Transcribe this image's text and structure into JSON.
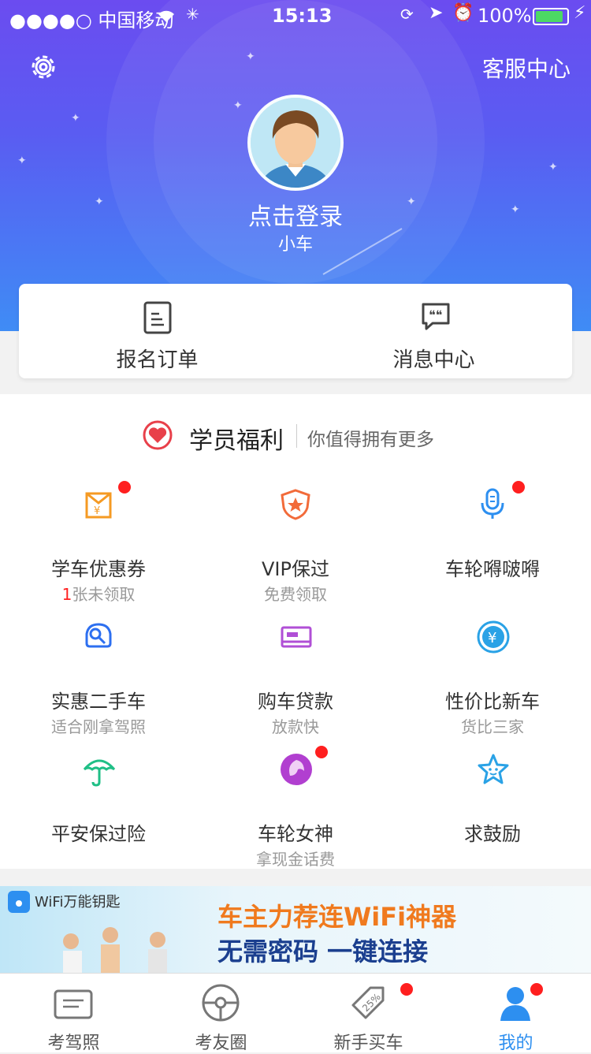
{
  "status_bar": {
    "carrier": "●●●●○ 中国移动",
    "time": "15:13",
    "battery": "100%",
    "battery_level": 1.0
  },
  "header": {
    "service_label": "客服中心",
    "login_label": "点击登录",
    "nickname": "小车"
  },
  "quick_actions": [
    {
      "label": "报名订单",
      "icon": "order-icon"
    },
    {
      "label": "消息中心",
      "icon": "message-icon"
    }
  ],
  "benefits": {
    "title": "学员福利",
    "subtitle": "你值得拥有更多",
    "items": [
      {
        "name": "学车优惠券",
        "sub_highlight": "1",
        "sub": "张未领取",
        "icon": "coupon-icon",
        "color": "#f59a23",
        "badge": true
      },
      {
        "name": "VIP保过",
        "sub_highlight": "",
        "sub": "免费领取",
        "icon": "shield-star-icon",
        "color": "#f26b3a",
        "badge": false
      },
      {
        "name": "车轮嘚啵嘚",
        "sub_highlight": "",
        "sub": "",
        "icon": "microphone-icon",
        "color": "#2d8ff0",
        "badge": true
      },
      {
        "name": "实惠二手车",
        "sub_highlight": "",
        "sub": "适合刚拿驾照",
        "icon": "car-key-icon",
        "color": "#2d6ff0",
        "badge": false
      },
      {
        "name": "购车贷款",
        "sub_highlight": "",
        "sub": "放款快",
        "icon": "card-icon",
        "color": "#b04fd6",
        "badge": false
      },
      {
        "name": "性价比新车",
        "sub_highlight": "",
        "sub": "货比三家",
        "icon": "yen-coin-icon",
        "color": "#2aa2e6",
        "badge": false
      },
      {
        "name": "平安保过险",
        "sub_highlight": "",
        "sub": "",
        "icon": "umbrella-icon",
        "color": "#1fbf86",
        "badge": false
      },
      {
        "name": "车轮女神",
        "sub_highlight": "",
        "sub": "拿现金话费",
        "icon": "goddess-icon",
        "color": "#b13fd0",
        "badge": true
      },
      {
        "name": "求鼓励",
        "sub_highlight": "",
        "sub": "",
        "icon": "star-icon",
        "color": "#2aa2e6",
        "badge": false
      }
    ]
  },
  "banner": {
    "logo_text": "WiFi万能钥匙",
    "line1": "车主力荐连WiFi神器",
    "line2": "无需密码  一键连接"
  },
  "tabs": [
    {
      "label": "考驾照",
      "icon": "license-icon",
      "active": false,
      "badge": false
    },
    {
      "label": "考友圈",
      "icon": "steering-wheel-icon",
      "active": false,
      "badge": false
    },
    {
      "label": "新手买车",
      "icon": "discount-tag-icon",
      "active": false,
      "badge": true
    },
    {
      "label": "我的",
      "icon": "profile-icon",
      "active": true,
      "badge": true
    }
  ],
  "colors": {
    "header_top": "#6b4cf0",
    "header_bottom": "#3f8cf5",
    "active_tab": "#2d8ff0",
    "badge": "#ff1f1f"
  }
}
